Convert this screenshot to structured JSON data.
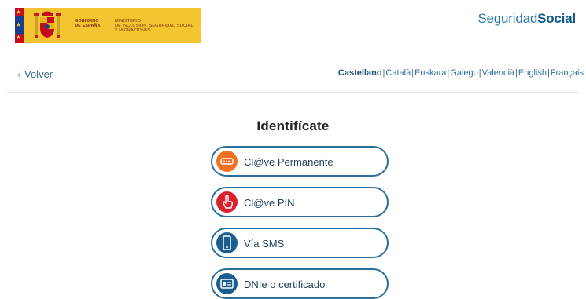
{
  "header": {
    "gov_line1": "GOBIERNO",
    "gov_line2": "DE ESPAÑA",
    "ministry_line1": "MINISTERIO",
    "ministry_line2": "DE INCLUSIÓN, SEGURIDAD SOCIAL",
    "ministry_line3": "Y MIGRACIONES",
    "brand_light": "Seguridad",
    "brand_bold": "Social"
  },
  "nav": {
    "back_label": "Volver",
    "languages": [
      "Castellano",
      "Català",
      "Euskara",
      "Galego",
      "Valencià",
      "English",
      "Français"
    ],
    "active_language": "Castellano"
  },
  "login": {
    "title": "Identifícate",
    "options": [
      {
        "label": "Cl@ve Permanente",
        "icon": "password-field-icon"
      },
      {
        "label": "Cl@ve PIN",
        "icon": "finger-tap-icon"
      },
      {
        "label": "Vía SMS",
        "icon": "mobile-phone-icon"
      },
      {
        "label": "DNIe o certificado",
        "icon": "id-card-icon"
      }
    ]
  },
  "colors": {
    "banner_yellow": "#f5c431",
    "brand_blue": "#2e7aa8",
    "button_border": "#2a6f9a",
    "clave_permanente": "#f26e22",
    "clave_pin": "#d8212c",
    "sms": "#1a5e8f",
    "dnie": "#1a5e8f"
  }
}
